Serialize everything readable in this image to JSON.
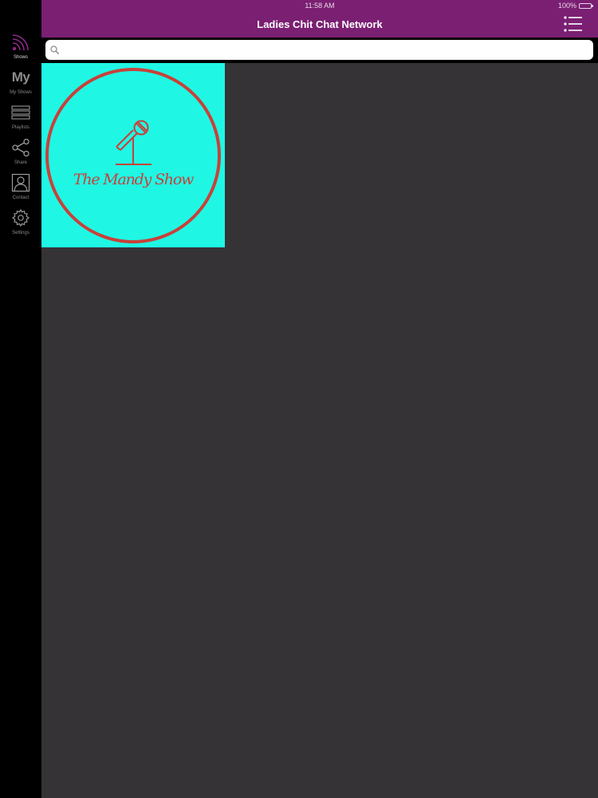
{
  "status_bar": {
    "time": "11:58 AM",
    "battery": "100%"
  },
  "header": {
    "title": "Ladies Chit Chat Network",
    "menu_icon": "list-menu-icon"
  },
  "search": {
    "placeholder": "",
    "value": "",
    "icon": "search-icon"
  },
  "sidebar": {
    "items": [
      {
        "label": "Shows",
        "icon": "podcast-signal-icon",
        "active": true
      },
      {
        "label": "My Shows",
        "icon": "my-text-icon",
        "icon_text": "My",
        "active": false
      },
      {
        "label": "Playlists",
        "icon": "stacked-bars-icon",
        "active": false
      },
      {
        "label": "Share",
        "icon": "share-icon",
        "active": false
      },
      {
        "label": "Contact",
        "icon": "contact-person-icon",
        "active": false
      },
      {
        "label": "Settings",
        "icon": "gear-icon",
        "active": false
      }
    ]
  },
  "shows": [
    {
      "title": "The Mandy Show",
      "artwork_colors": {
        "background": "#1ff7e4",
        "ring": "#c8413a"
      }
    }
  ],
  "colors": {
    "header_purple": "#7b1f73",
    "sidebar_black": "#000000",
    "content_gray": "#353336"
  }
}
